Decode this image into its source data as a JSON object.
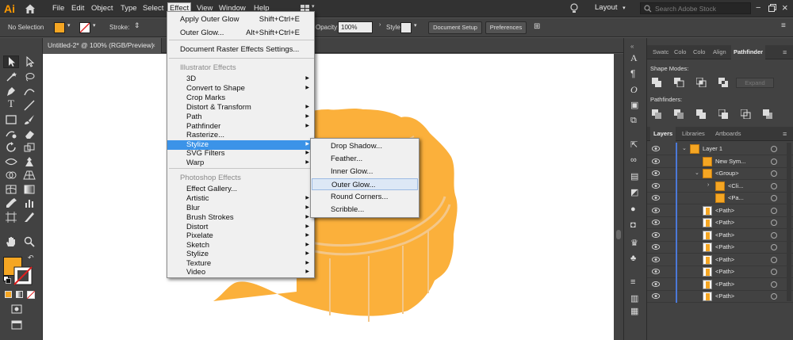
{
  "app": {
    "logo": "Ai"
  },
  "menubar": {
    "items": [
      "File",
      "Edit",
      "Object",
      "Type",
      "Select",
      "Effect",
      "View",
      "Window",
      "Help"
    ],
    "active": "Effect",
    "workspace": "Layout",
    "stock_placeholder": "Search Adobe Stock"
  },
  "controlbar": {
    "selection": "No Selection",
    "stroke_label": "Stroke:",
    "opacity_label": "Opacity:",
    "opacity_value": "100%",
    "style_label": "Style:",
    "doc_setup": "Document Setup",
    "preferences": "Preferences"
  },
  "document": {
    "tab_title": "Untitled-2* @ 100% (RGB/Preview)",
    "close": "×"
  },
  "effect_menu": {
    "items": [
      {
        "label": "Apply Outer Glow",
        "shortcut": "Shift+Ctrl+E"
      },
      {
        "label": "Outer Glow...",
        "shortcut": "Alt+Shift+Ctrl+E"
      },
      {
        "label": "Document Raster Effects Settings..."
      },
      {
        "label": "Illustrator Effects",
        "header": true
      },
      {
        "label": "3D",
        "submenu": true
      },
      {
        "label": "Convert to Shape",
        "submenu": true
      },
      {
        "label": "Crop Marks"
      },
      {
        "label": "Distort & Transform",
        "submenu": true
      },
      {
        "label": "Path",
        "submenu": true
      },
      {
        "label": "Pathfinder",
        "submenu": true
      },
      {
        "label": "Rasterize..."
      },
      {
        "label": "Stylize",
        "submenu": true,
        "highlighted": true
      },
      {
        "label": "SVG Filters",
        "submenu": true
      },
      {
        "label": "Warp",
        "submenu": true
      },
      {
        "label": "Photoshop Effects",
        "header": true
      },
      {
        "label": "Effect Gallery..."
      },
      {
        "label": "Artistic",
        "submenu": true
      },
      {
        "label": "Blur",
        "submenu": true
      },
      {
        "label": "Brush Strokes",
        "submenu": true
      },
      {
        "label": "Distort",
        "submenu": true
      },
      {
        "label": "Pixelate",
        "submenu": true
      },
      {
        "label": "Sketch",
        "submenu": true
      },
      {
        "label": "Stylize",
        "submenu": true
      },
      {
        "label": "Texture",
        "submenu": true
      },
      {
        "label": "Video",
        "submenu": true
      }
    ]
  },
  "stylize_submenu": {
    "items": [
      "Drop Shadow...",
      "Feather...",
      "Inner Glow...",
      "Outer Glow...",
      "Round Corners...",
      "Scribble..."
    ],
    "highlighted": "Outer Glow..."
  },
  "pathfinder_panel": {
    "tabs": [
      "Swatc",
      "Colo",
      "Colo",
      "Align",
      "Pathfinder"
    ],
    "active_tab": "Pathfinder",
    "shape_modes_label": "Shape Modes:",
    "pathfinders_label": "Pathfinders:",
    "expand": "Expand"
  },
  "layers_panel": {
    "tabs": [
      "Layers",
      "Libraries",
      "Artboards"
    ],
    "active_tab": "Layers",
    "rows": [
      {
        "name": "Layer 1",
        "indent": 0,
        "expanded": true,
        "thumb": "orange"
      },
      {
        "name": "New Sym...",
        "indent": 1,
        "thumb": "orange"
      },
      {
        "name": "<Group>",
        "indent": 1,
        "expanded": true,
        "thumb": "orange"
      },
      {
        "name": "<Cli...",
        "indent": 2,
        "collapsed": true,
        "thumb": "orange"
      },
      {
        "name": "<Pa...",
        "indent": 2,
        "thumb": "orange"
      },
      {
        "name": "<Path>",
        "indent": 1,
        "thumb": "white"
      },
      {
        "name": "<Path>",
        "indent": 1,
        "thumb": "white"
      },
      {
        "name": "<Path>",
        "indent": 1,
        "thumb": "white"
      },
      {
        "name": "<Path>",
        "indent": 1,
        "thumb": "white"
      },
      {
        "name": "<Path>",
        "indent": 1,
        "thumb": "white"
      },
      {
        "name": "<Path>",
        "indent": 1,
        "thumb": "white"
      },
      {
        "name": "<Path>",
        "indent": 1,
        "thumb": "white"
      },
      {
        "name": "<Path>",
        "indent": 1,
        "thumb": "white"
      }
    ]
  },
  "colors": {
    "fill": "#f5a623",
    "mooncake": "#fbb03b",
    "mooncake_line": "#f3c78a",
    "menu_highlight": "#3b93e8",
    "layer_bar": "#4b79d8"
  }
}
